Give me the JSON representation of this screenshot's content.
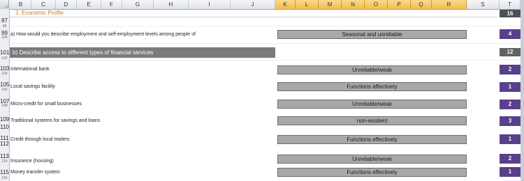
{
  "columns": [
    "B",
    "C",
    "D",
    "E",
    "F",
    "G",
    "H",
    "I",
    "J",
    "K",
    "L",
    "M",
    "N",
    "O",
    "P",
    "Q",
    "R",
    "S",
    "T"
  ],
  "row_numbers": [
    {
      "n": "97",
      "small": false
    },
    {
      "n": "98",
      "small": true
    },
    {
      "n": "99",
      "small": false
    },
    {
      "n": "100",
      "small": true
    },
    {
      "n": "101",
      "small": false
    },
    {
      "n": "102",
      "small": true
    },
    {
      "n": "103",
      "small": false
    },
    {
      "n": "104",
      "small": true
    },
    {
      "n": "105",
      "small": false
    },
    {
      "n": "106",
      "small": true
    },
    {
      "n": "107",
      "small": false
    },
    {
      "n": "108",
      "small": true
    },
    {
      "n": "109",
      "small": false
    },
    {
      "n": "110",
      "small": false
    },
    {
      "n": "111",
      "small": false
    },
    {
      "n": "112",
      "small": false
    },
    {
      "n": "113",
      "small": false
    },
    {
      "n": "114",
      "small": true
    },
    {
      "n": "115",
      "small": false
    },
    {
      "n": "116",
      "small": true
    }
  ],
  "section_title": "2. Economic Profile",
  "section_score": "16",
  "question_a": {
    "label": "a)  How would you describe employment and self-employment levels among people of",
    "answer": "Seasonal and unreliable",
    "score": "4"
  },
  "question_b": {
    "label": "b)  Describe access to different types of financial services",
    "score": "12"
  },
  "services": [
    {
      "label": "International bank",
      "answer": "Unreliable/weak",
      "score": "2"
    },
    {
      "label": "Local savings facility",
      "answer": "Functions effectively",
      "score": "1"
    },
    {
      "label": "Micro-credit for small businesses",
      "answer": "Unreliable/weak",
      "score": "2"
    },
    {
      "label": "Traditional systems for savings and loans",
      "answer": "non-existent",
      "score": "3"
    },
    {
      "label": "Credit through local traders",
      "answer": "Functions effectively",
      "score": "1"
    },
    {
      "label": "Insurance (housing)",
      "answer": "Unreliable/weak",
      "score": "2"
    },
    {
      "label": "Money transfer system",
      "answer": "Functions effectively",
      "score": "1"
    }
  ],
  "colors": {
    "title_text": "#c57a26",
    "section_bg": "#7b7b7b",
    "answer_bg": "#a8a8a8",
    "score_purple": "#5a3f8c",
    "selected_col_header": "#f1bd4f"
  }
}
